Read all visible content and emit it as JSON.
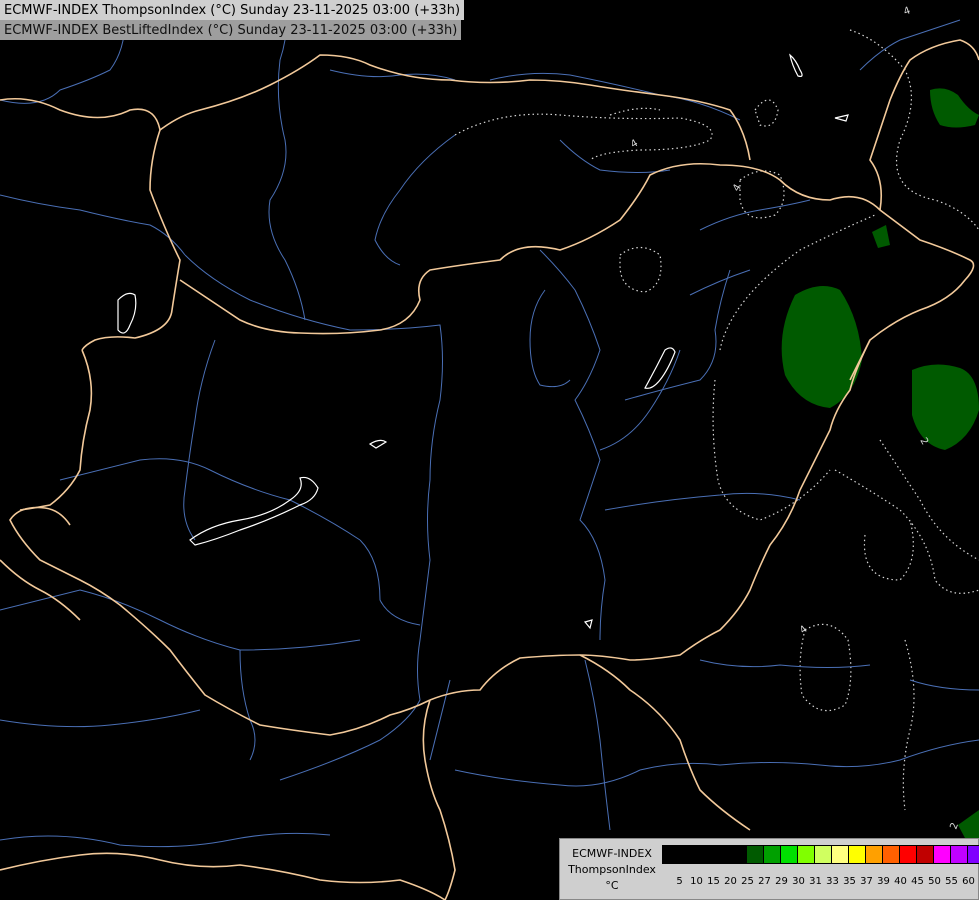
{
  "header": {
    "line1": "ECMWF-INDEX ThompsonIndex (°C) Sunday 23-11-2025 03:00 (+33h)",
    "line2": "ECMWF-INDEX BestLiftedIndex (°C) Sunday 23-11-2025 03:00 (+33h)"
  },
  "map": {
    "background": "#000000",
    "border_color": "#f2c99a",
    "river_color": "#4a6fb5",
    "lake_outline_color": "#ffffff",
    "field_color": "#005a00",
    "contour_labels": [
      "4",
      "4",
      "4",
      "4",
      "2",
      "2"
    ]
  },
  "legend": {
    "line1": "ECMWF-INDEX",
    "line2": "ThompsonIndex",
    "unit": "°C",
    "colors": [
      "#000000",
      "#000000",
      "#000000",
      "#000000",
      "#000000",
      "#005a00",
      "#00a000",
      "#00e000",
      "#80ff00",
      "#d0ff60",
      "#ffff80",
      "#ffff00",
      "#ffa000",
      "#ff6000",
      "#ff0000",
      "#c00000",
      "#ff00ff",
      "#c000ff",
      "#8000ff",
      "#4000ff",
      "#0000ff"
    ],
    "ticks": [
      "5",
      "10",
      "15",
      "20",
      "25",
      "27",
      "29",
      "30",
      "31",
      "33",
      "35",
      "37",
      "39",
      "40",
      "45",
      "50",
      "55",
      "60"
    ]
  }
}
